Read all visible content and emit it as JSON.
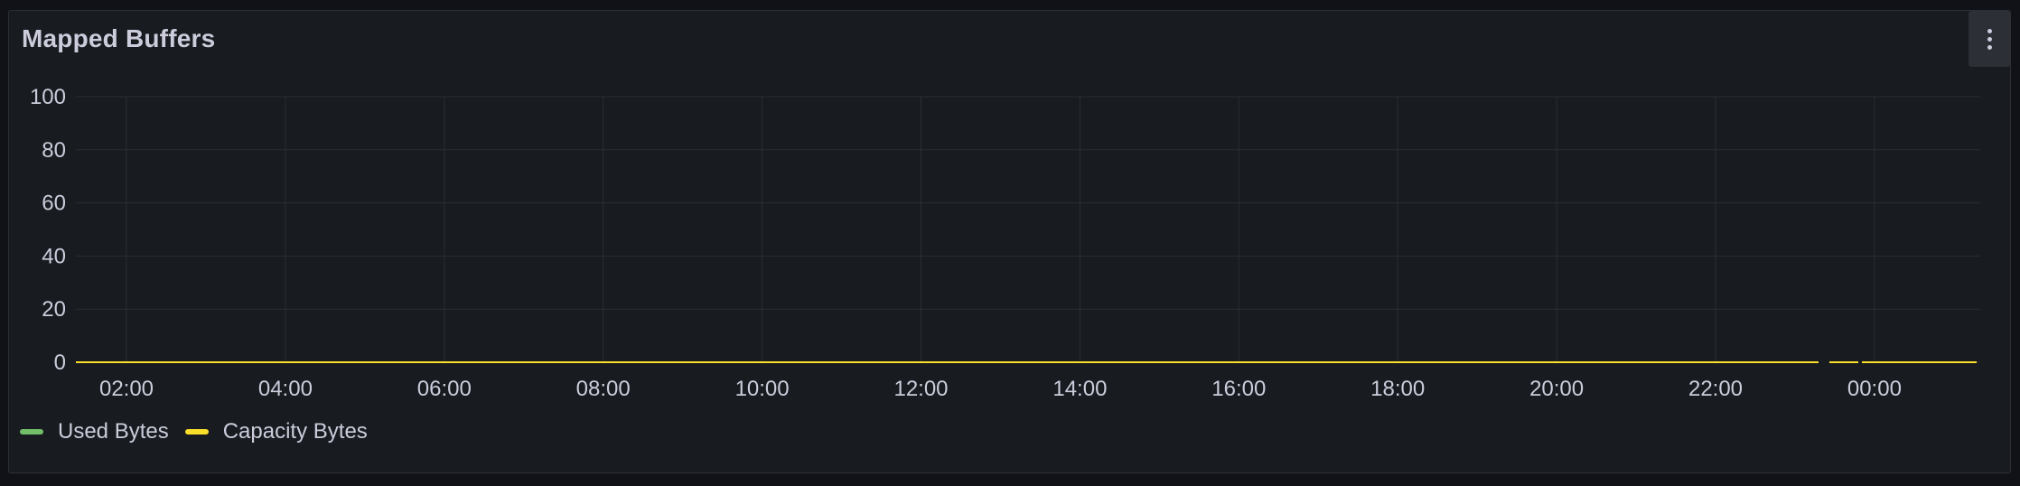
{
  "panel": {
    "title": "Mapped Buffers",
    "menu_icon": "kebab-menu-icon"
  },
  "colors": {
    "background": "#181b1f",
    "grid": "#2a2d33",
    "text": "#ccccdc"
  },
  "chart_data": {
    "type": "line",
    "title": "Mapped Buffers",
    "xlabel": "",
    "ylabel": "",
    "x_ticks": [
      "02:00",
      "04:00",
      "06:00",
      "08:00",
      "10:00",
      "12:00",
      "14:00",
      "16:00",
      "18:00",
      "20:00",
      "22:00",
      "00:00"
    ],
    "y_ticks": [
      0,
      20,
      40,
      60,
      80,
      100
    ],
    "xlim": [
      "01:00",
      "23:22"
    ],
    "ylim": [
      0,
      100
    ],
    "grid": true,
    "legend_position": "bottom-left",
    "series": [
      {
        "name": "Used Bytes",
        "color": "#73bf69",
        "segments": [
          [
            [
              "01:00",
              0
            ],
            [
              "23:22",
              0
            ]
          ]
        ]
      },
      {
        "name": "Capacity Bytes",
        "color": "#fade2a",
        "segments": [
          [
            [
              "01:00",
              0
            ],
            [
              "23:22",
              0
            ]
          ]
        ]
      }
    ]
  }
}
